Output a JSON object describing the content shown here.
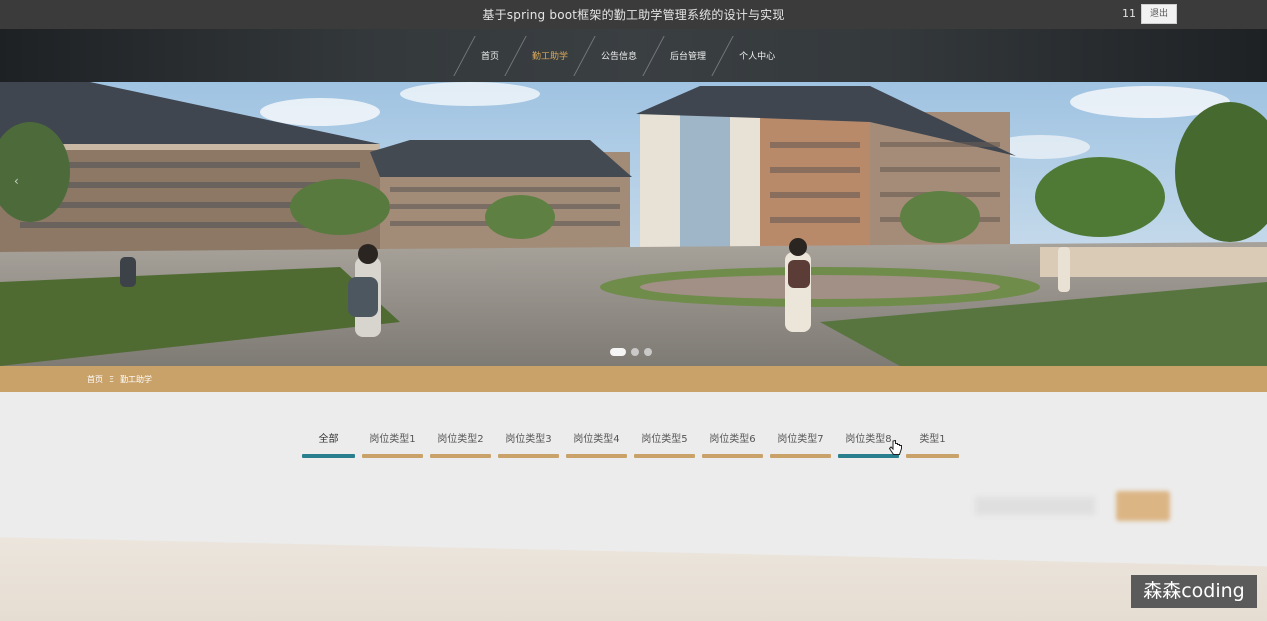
{
  "header": {
    "title": "基于spring boot框架的勤工助学管理系统的设计与实现",
    "user": "11",
    "logout_label": "退出"
  },
  "nav": {
    "items": [
      {
        "label": "首页",
        "active": false
      },
      {
        "label": "勤工助学",
        "active": true
      },
      {
        "label": "公告信息",
        "active": false
      },
      {
        "label": "后台管理",
        "active": false
      },
      {
        "label": "个人中心",
        "active": false
      }
    ],
    "active_color": "#d9a95a"
  },
  "banner": {
    "prev_icon": "chevron-left-icon",
    "slide_count": 3,
    "active_slide": 0
  },
  "breadcrumb": {
    "home": "首页",
    "separator": "Ξ",
    "current": "勤工助学"
  },
  "tabs": [
    {
      "label": "全部",
      "style": "blue"
    },
    {
      "label": "岗位类型1",
      "style": "gold"
    },
    {
      "label": "岗位类型2",
      "style": "gold"
    },
    {
      "label": "岗位类型3",
      "style": "gold"
    },
    {
      "label": "岗位类型4",
      "style": "gold"
    },
    {
      "label": "岗位类型5",
      "style": "gold"
    },
    {
      "label": "岗位类型6",
      "style": "gold"
    },
    {
      "label": "岗位类型7",
      "style": "gold"
    },
    {
      "label": "岗位类型8",
      "style": "blue"
    },
    {
      "label": "类型1",
      "style": "gold"
    }
  ],
  "colors": {
    "accent_gold": "#c9a26a",
    "accent_blue": "#2a7f8e",
    "header_bg": "#3b3b3b"
  },
  "watermark": "森森coding"
}
